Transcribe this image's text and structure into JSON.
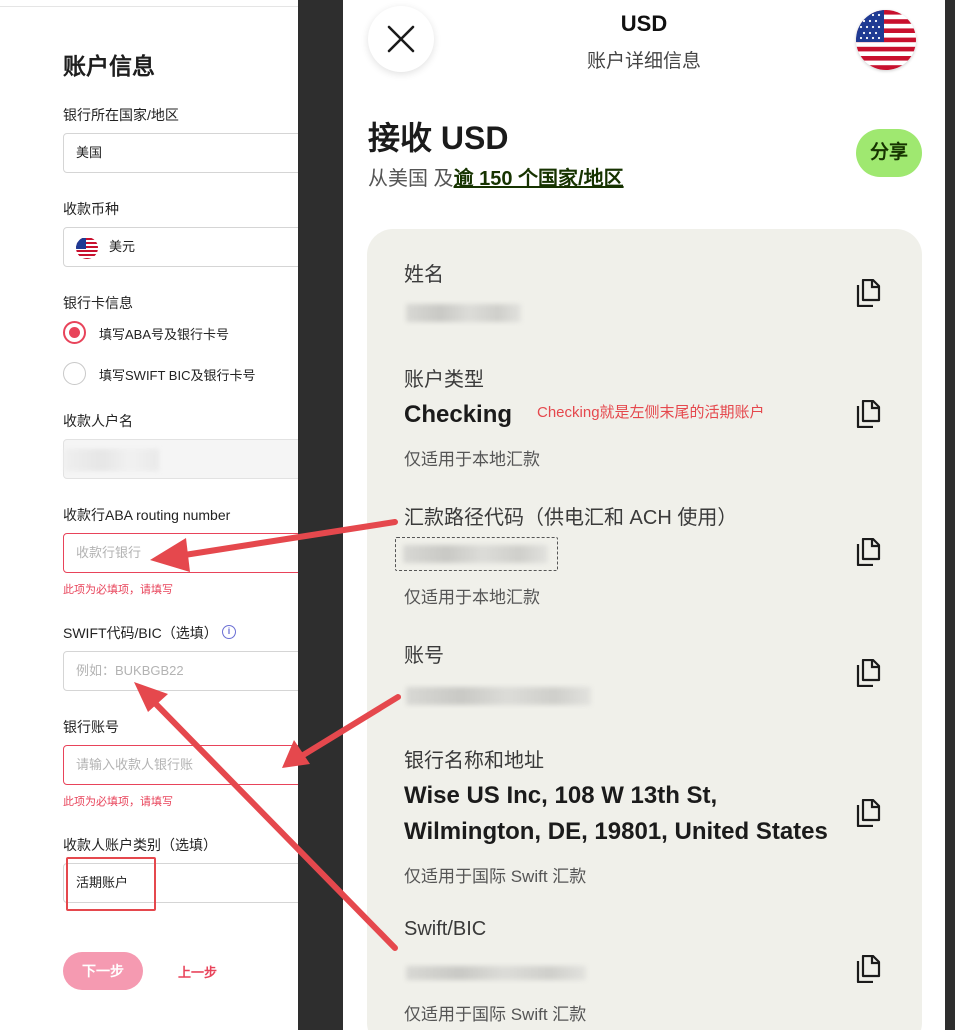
{
  "form": {
    "title": "账户信息",
    "country_label": "银行所在国家/地区",
    "country_value": "美国",
    "currency_label": "收款币种",
    "currency_value": "美元",
    "bank_card_label": "银行卡信息",
    "radio_aba": "填写ABA号及银行卡号",
    "radio_swift": "填写SWIFT BIC及银行卡号",
    "payee_name_label": "收款人户名",
    "aba_label": "收款行ABA routing number",
    "aba_placeholder": "收款行银行",
    "required_error": "此项为必填项，请填写",
    "swift_label": "SWIFT代码/BIC（选填）",
    "swift_placeholder": "例如：BUKBGB22",
    "account_no_label": "银行账号",
    "account_no_placeholder": "请输入收款人银行账",
    "account_type_label": "收款人账户类别（选填）",
    "account_type_value": "活期账户",
    "next_button": "下一步",
    "prev_button": "上一步"
  },
  "detail": {
    "currency": "USD",
    "subtitle": "账户详细信息",
    "receive_title": "接收 USD",
    "from_prefix": "从美国 及",
    "from_link": "逾 150 个国家/地区",
    "share_button": "分享",
    "name_label": "姓名",
    "account_type_label": "账户类型",
    "account_type_value": "Checking",
    "annotation": "Checking就是左侧末尾的活期账户",
    "local_only_note": "仅适用于本地汇款",
    "routing_label": "汇款路径代码（供电汇和 ACH 使用）",
    "account_number_label": "账号",
    "bank_name_label": "银行名称和地址",
    "bank_address_line1": "Wise US Inc, 108 W 13th St,",
    "bank_address_line2": "Wilmington, DE, 19801, United States",
    "intl_swift_note": "仅适用于国际 Swift 汇款",
    "swift_label": "Swift/BIC"
  },
  "colors": {
    "accent_pink": "#e8435a",
    "wise_green": "#9fe870",
    "wise_dark": "#163300",
    "arrow_red": "#e5484d"
  }
}
